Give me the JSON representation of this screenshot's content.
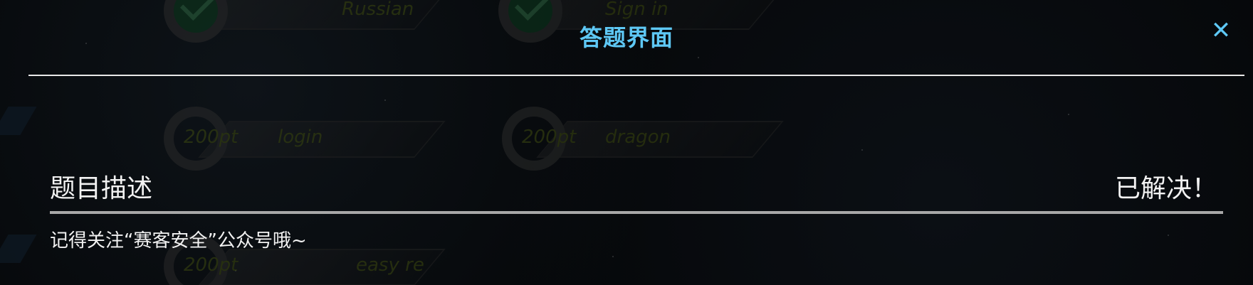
{
  "background": {
    "cards": [
      {
        "points": "",
        "name": "Russian",
        "solved": true
      },
      {
        "points": "",
        "name": "Sign in",
        "solved": true
      },
      {
        "points": "200pt",
        "name": "login",
        "solved": false
      },
      {
        "points": "200pt",
        "name": "dragon",
        "solved": false
      },
      {
        "points": "200pt",
        "name": "easy re",
        "solved": false
      }
    ]
  },
  "modal": {
    "title": "答题界面",
    "close_icon": "close-icon",
    "section_title": "题目描述",
    "status": "已解决！",
    "description": "记得关注“赛客安全”公众号哦~"
  },
  "colors": {
    "accent": "#5ec8f5",
    "text": "#f2f2f2",
    "background": "#050709",
    "divider": "#a8a8a8"
  }
}
